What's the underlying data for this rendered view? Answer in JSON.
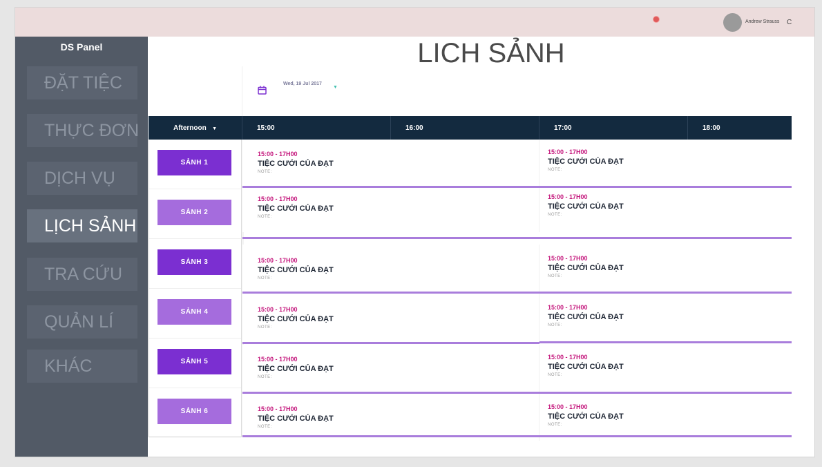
{
  "user": {
    "name": "Andrew Strauss",
    "caret": "C"
  },
  "sidebar": {
    "brand": "DS Panel",
    "items": [
      {
        "label": "ĐẶT TIỆC"
      },
      {
        "label": "THỰC ĐƠN"
      },
      {
        "label": "DỊCH VỤ"
      },
      {
        "label": "LỊCH SẢNH",
        "active": true
      },
      {
        "label": "TRA CỨU"
      },
      {
        "label": "QUẢN LÍ"
      },
      {
        "label": "KHÁC"
      }
    ]
  },
  "page": {
    "title": "LICH SẢNH"
  },
  "datebar": {
    "date": "Wed, 19 Jul 2017",
    "caret": "▼"
  },
  "timeline": {
    "period": "Afternoon",
    "period_caret": "▼",
    "slots": [
      "15:00",
      "16:00",
      "17:00",
      "18:00"
    ]
  },
  "rooms": [
    "SẢNH 1",
    "SẢNH 2",
    "SẢNH 3",
    "SẢNH 4",
    "SẢNH 5",
    "SẢNH 6"
  ],
  "events": {
    "time": "15:00 - 17H00",
    "title": "TIỆC CƯỚI CỦA ĐẠT",
    "note": "NOTE:"
  },
  "colors": {
    "sidebar": "#525a66",
    "header_dark": "#132a3f",
    "room_dark": "#7b2fd1",
    "room_light": "#a56cdd",
    "event_time": "#c4167c",
    "row_line": "#a97ddc"
  }
}
